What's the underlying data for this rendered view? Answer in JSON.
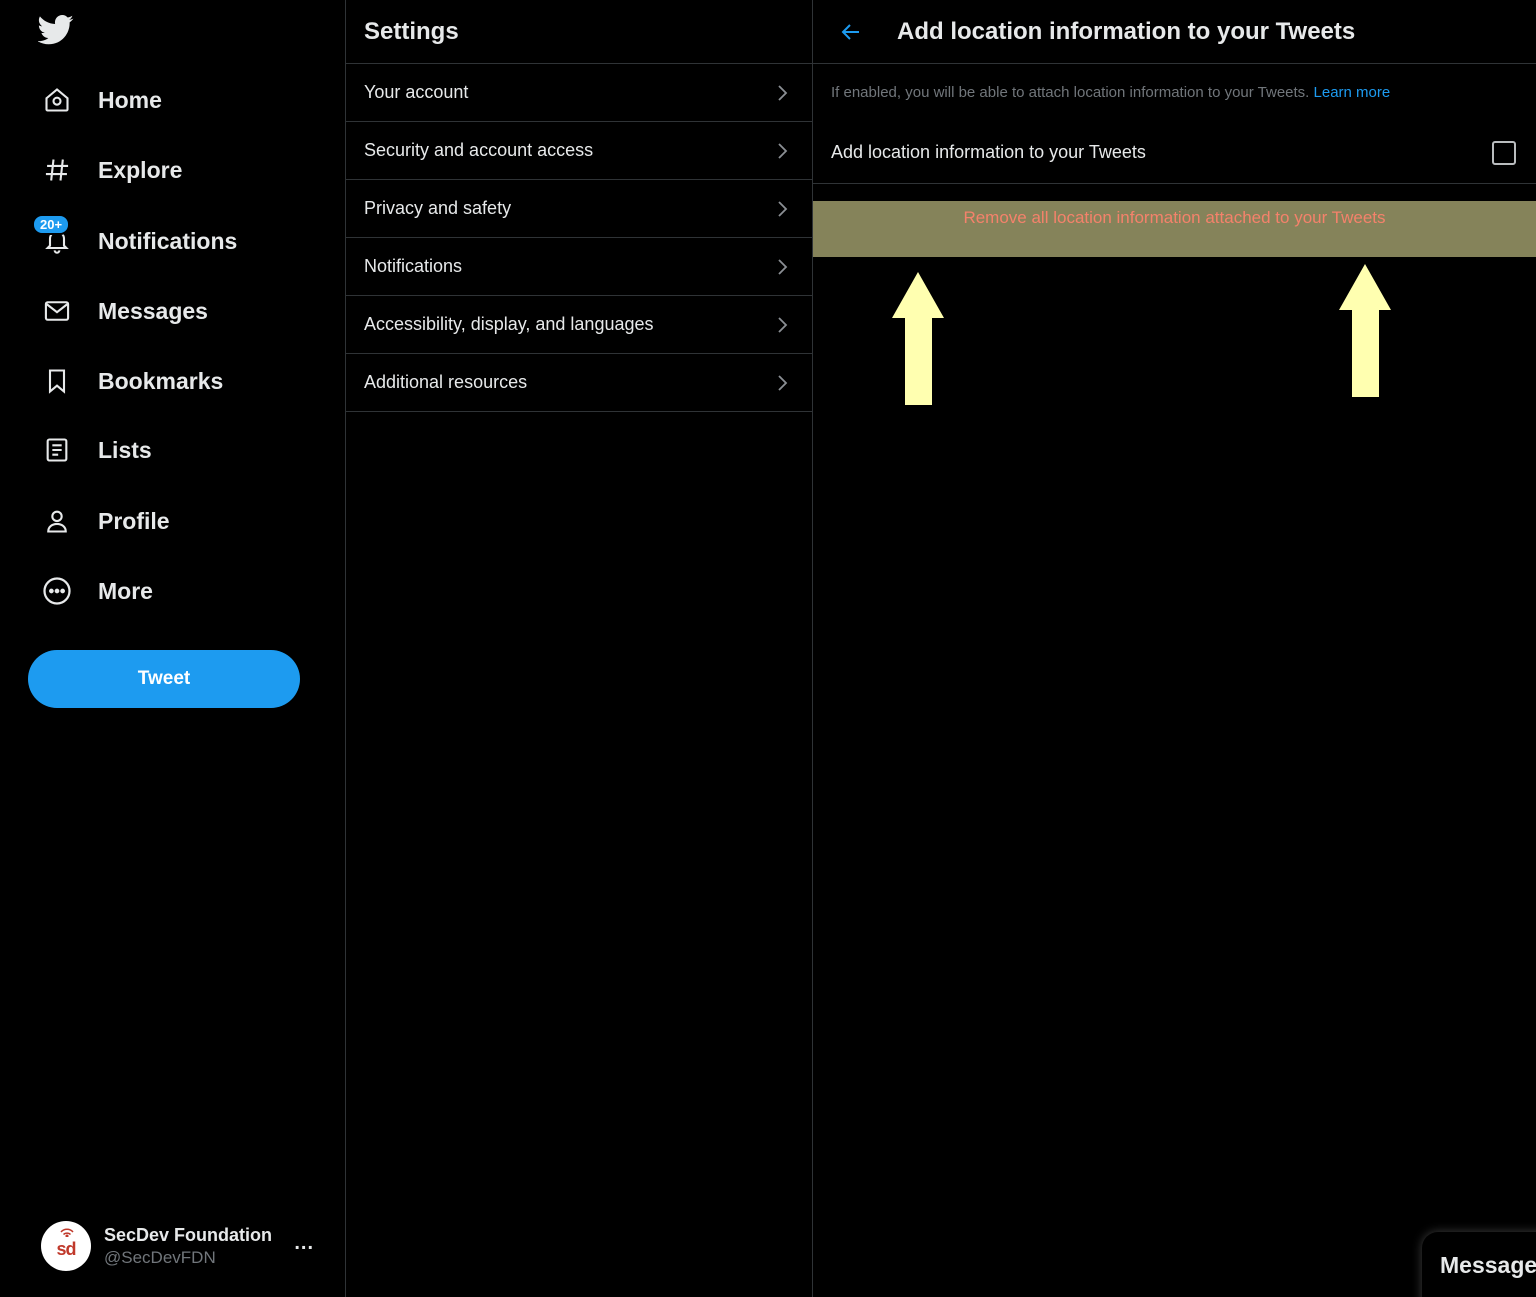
{
  "sidebar": {
    "nav": [
      {
        "label": "Home",
        "icon": "home-icon"
      },
      {
        "label": "Explore",
        "icon": "hashtag-icon"
      },
      {
        "label": "Notifications",
        "icon": "bell-icon",
        "badge": "20+"
      },
      {
        "label": "Messages",
        "icon": "envelope-icon"
      },
      {
        "label": "Bookmarks",
        "icon": "bookmark-icon"
      },
      {
        "label": "Lists",
        "icon": "list-icon"
      },
      {
        "label": "Profile",
        "icon": "person-icon"
      },
      {
        "label": "More",
        "icon": "more-circle-icon"
      }
    ],
    "tweet_button": "Tweet",
    "account": {
      "name": "SecDev Foundation",
      "handle": "@SecDevFDN",
      "avatar_text": "sd",
      "more": "..."
    }
  },
  "settings": {
    "title": "Settings",
    "items": [
      {
        "label": "Your account"
      },
      {
        "label": "Security and account access"
      },
      {
        "label": "Privacy and safety"
      },
      {
        "label": "Notifications"
      },
      {
        "label": "Accessibility, display, and languages"
      },
      {
        "label": "Additional resources"
      }
    ]
  },
  "detail": {
    "title": "Add location information to your Tweets",
    "description": "If enabled, you will be able to attach location information to your Tweets.",
    "learn_more": "Learn more",
    "toggle_label": "Add location information to your Tweets",
    "toggle_checked": false,
    "remove_action": "Remove all location information attached to your Tweets"
  },
  "messages_drawer": {
    "label": "Messages"
  },
  "colors": {
    "accent": "#1d9bf0",
    "background": "#000000",
    "highlight": "#85835a",
    "remove_text": "#f4826b",
    "annotation_arrow": "#ffffb0"
  }
}
